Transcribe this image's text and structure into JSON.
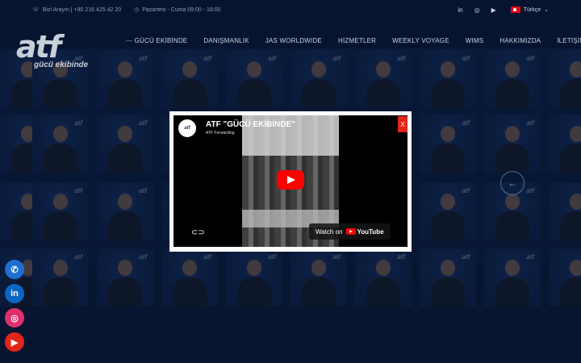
{
  "topbar": {
    "phone": "Bizi Arayın | +90 216 425 42 20",
    "hours": "Pazartesi - Cuma 09:00 - 18:00",
    "social": [
      "in",
      "ig",
      "yt"
    ],
    "language": "Türkçe"
  },
  "brand": {
    "mark": "atf",
    "tagline": "gücü ekibinde"
  },
  "nav": {
    "items": [
      {
        "label": "GÜCÜ EKİBİNDE",
        "active": true
      },
      {
        "label": "DANIŞMANLIK"
      },
      {
        "label": "JAS WORLDWIDE"
      },
      {
        "label": "HİZMETLER"
      },
      {
        "label": "WEEKLY VOYAGE"
      },
      {
        "label": "WIMS"
      },
      {
        "label": "HAKKIMIZDA"
      },
      {
        "label": "İLETİŞİM"
      }
    ]
  },
  "modal": {
    "close_label": "X",
    "video_title": "ATF \"GÜCÜ EKİBİNDE\"",
    "channel": "ATF Forwarding",
    "channel_avatar": "atf",
    "watch_label": "Watch on",
    "youtube_label": "YouTube"
  },
  "bg_logo": "atf",
  "icons": {
    "phone": "phone-icon",
    "linkedin": "linkedin-icon",
    "instagram": "instagram-icon",
    "youtube": "youtube-icon",
    "link": "link-icon",
    "play": "play-icon",
    "arrow": "arrow-left-icon"
  }
}
